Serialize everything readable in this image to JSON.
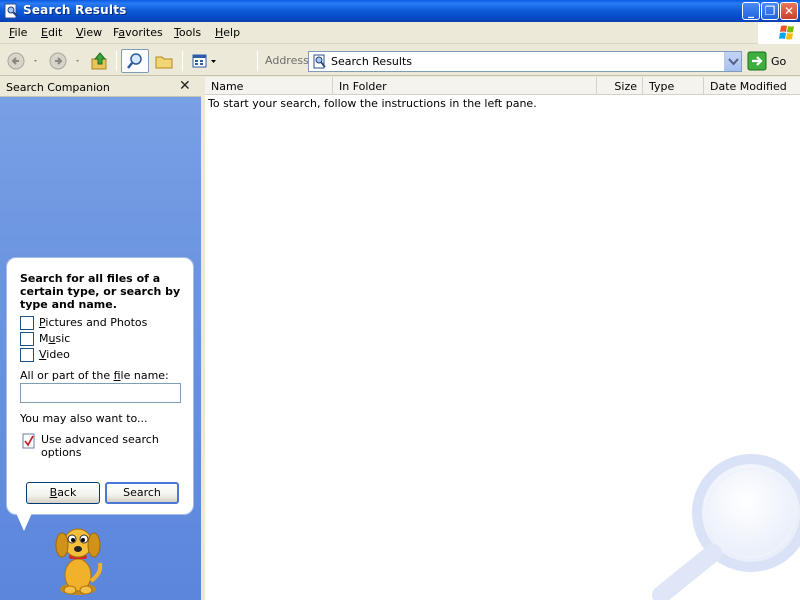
{
  "window": {
    "title": "Search Results",
    "minimize": "_",
    "maximize": "❐",
    "close": "✕"
  },
  "menu": {
    "file": {
      "u": "F",
      "rest": "ile"
    },
    "edit": {
      "u": "E",
      "rest": "dit"
    },
    "view": {
      "u": "V",
      "rest": "iew"
    },
    "favorites": {
      "pre": "F",
      "u": "a",
      "rest": "vorites"
    },
    "tools": {
      "u": "T",
      "rest": "ools"
    },
    "help": {
      "u": "H",
      "rest": "elp"
    }
  },
  "address": {
    "label": "Address",
    "value": "Search Results",
    "go_label": "Go"
  },
  "search_companion": {
    "header": "Search Companion",
    "close": "✕",
    "prompt": "Search for all files of a certain type, or search by type and name.",
    "options": [
      {
        "u": "P",
        "rest": "ictures and Photos"
      },
      {
        "pre": "M",
        "u": "u",
        "rest": "sic"
      },
      {
        "u": "V",
        "rest": "ideo"
      }
    ],
    "filename_label": {
      "pre": "All or part of the ",
      "u": "f",
      "rest": "ile name:"
    },
    "filename_value": "",
    "also_label": "You may also want to...",
    "advanced_label": "Use advanced search options",
    "back_label": {
      "u": "B",
      "rest": "ack"
    },
    "search_label": "Search"
  },
  "results": {
    "columns": [
      "Name",
      "In Folder",
      "Size",
      "Type",
      "Date Modified"
    ],
    "instructions": "To start your search, follow the instructions in the left pane."
  },
  "colors": {
    "titlebar": "#0a5ae0",
    "pane_blue": "#7aa1e6",
    "chrome": "#ece9d8"
  }
}
